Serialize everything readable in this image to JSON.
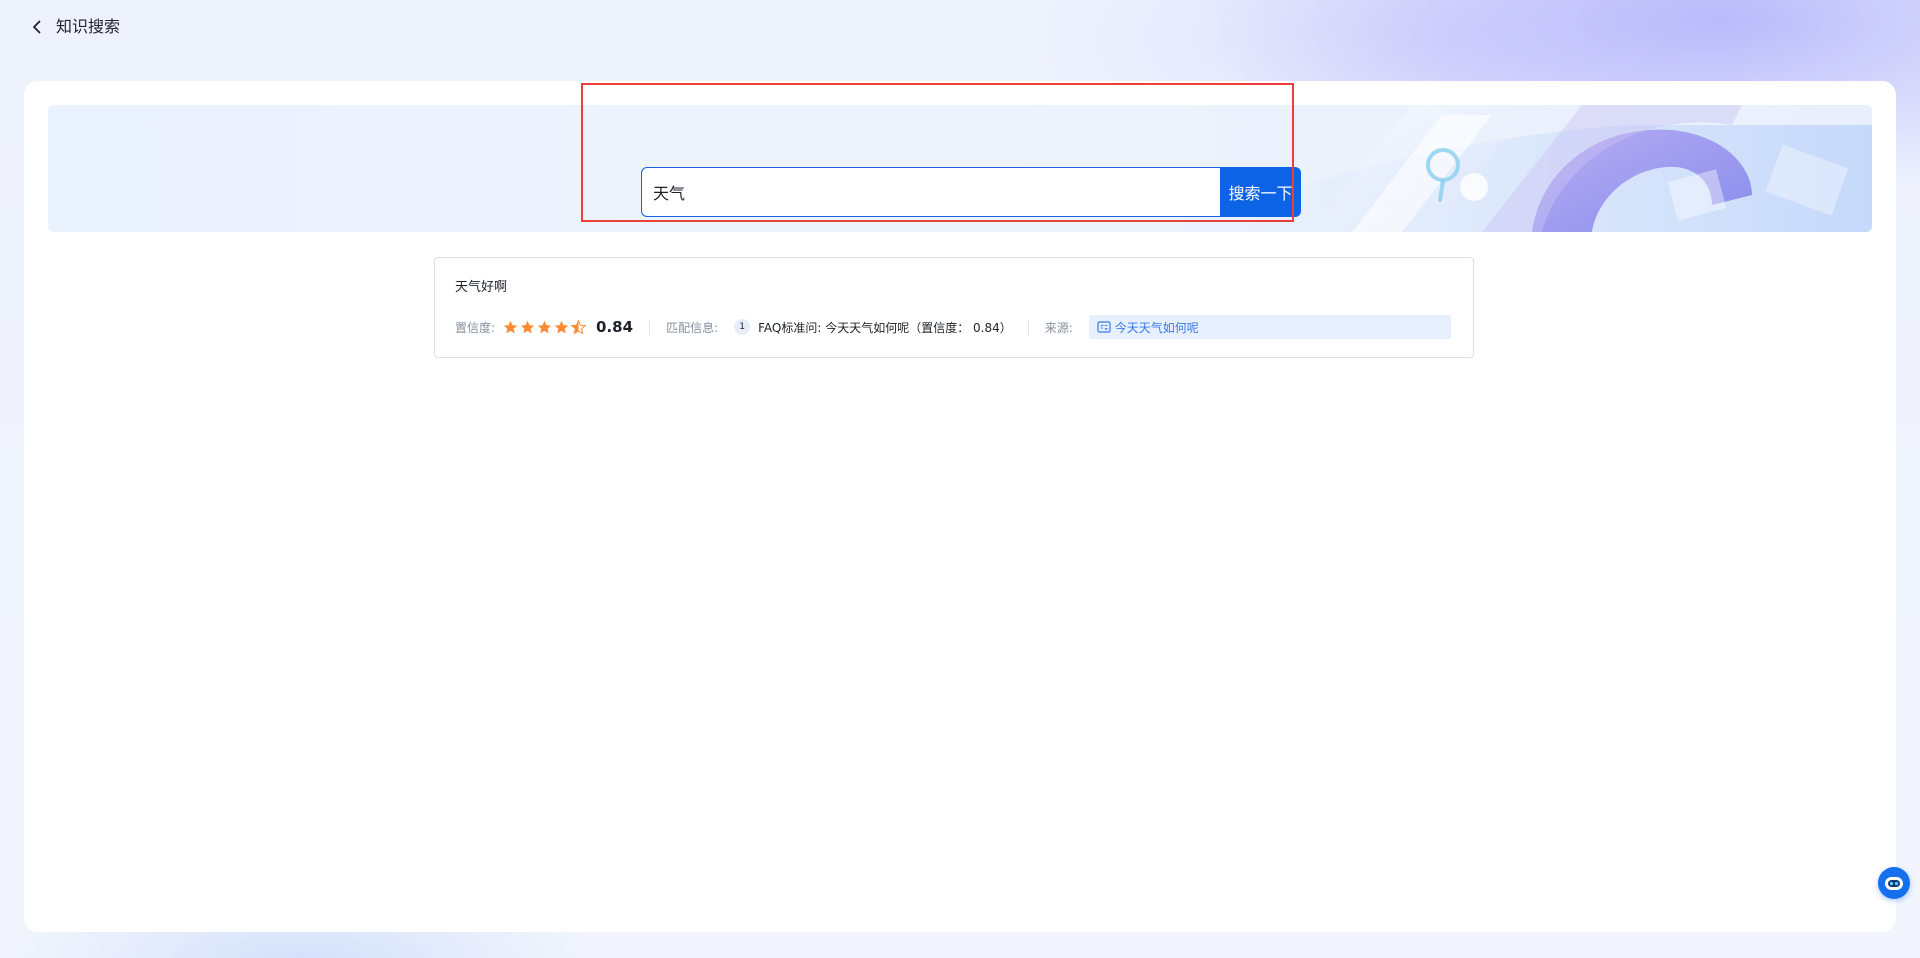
{
  "header": {
    "title": "知识搜索"
  },
  "search": {
    "value": "天气",
    "button_label": "搜索一下"
  },
  "result": {
    "title": "天气好啊",
    "confidence_label": "置信度:",
    "rating_stars": 4.5,
    "rating_max": 5,
    "score": "0.84",
    "match_label": "匹配信息:",
    "match_index": "1",
    "match_text": "FAQ标准问: 今天天气如何呢（置信度： 0.84）",
    "source_label": "来源:",
    "source_text": "今天天气如何呢"
  },
  "colors": {
    "accent": "#0d63e6",
    "star": "#ff8a34",
    "highlight": "#e8403a",
    "source_text": "#3b78e7"
  },
  "icons": {
    "back": "chevron-left-icon",
    "star": "star-icon",
    "source": "faq-doc-icon",
    "assistant": "robot-icon"
  }
}
